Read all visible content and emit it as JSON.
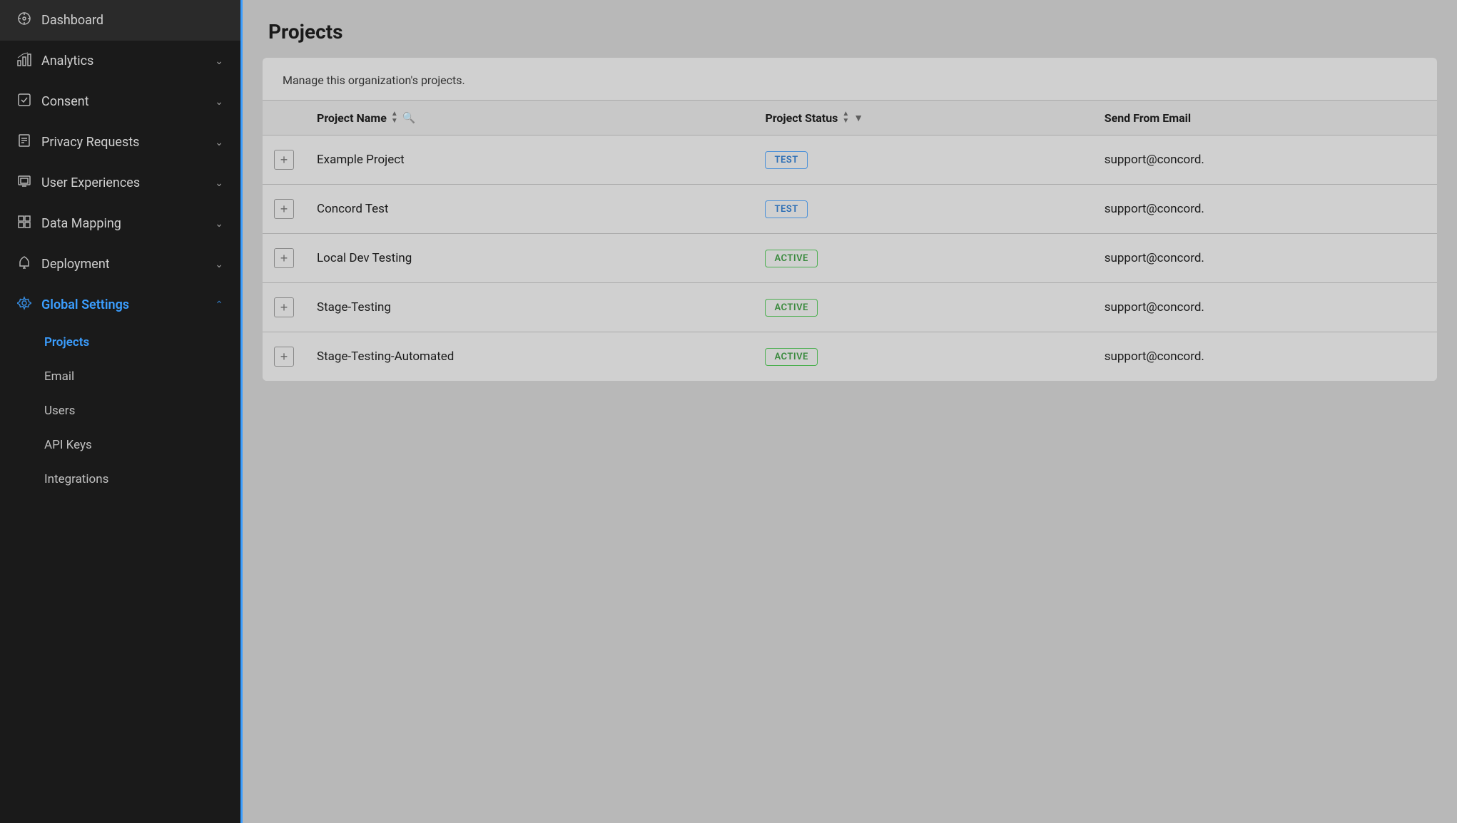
{
  "sidebar": {
    "items": [
      {
        "id": "dashboard",
        "label": "Dashboard",
        "icon": "⊙",
        "hasChevron": false,
        "active": false,
        "subItems": []
      },
      {
        "id": "analytics",
        "label": "Analytics",
        "icon": "📈",
        "hasChevron": true,
        "chevronDir": "down",
        "active": false,
        "subItems": []
      },
      {
        "id": "consent",
        "label": "Consent",
        "icon": "☑",
        "hasChevron": true,
        "chevronDir": "down",
        "active": false,
        "subItems": []
      },
      {
        "id": "privacy-requests",
        "label": "Privacy Requests",
        "icon": "🗂",
        "hasChevron": true,
        "chevronDir": "down",
        "active": false,
        "subItems": []
      },
      {
        "id": "user-experiences",
        "label": "User Experiences",
        "icon": "🖼",
        "hasChevron": true,
        "chevronDir": "down",
        "active": false,
        "subItems": []
      },
      {
        "id": "data-mapping",
        "label": "Data Mapping",
        "icon": "⊞",
        "hasChevron": true,
        "chevronDir": "down",
        "active": false,
        "subItems": []
      },
      {
        "id": "deployment",
        "label": "Deployment",
        "icon": "🔔",
        "hasChevron": true,
        "chevronDir": "down",
        "active": false,
        "subItems": []
      },
      {
        "id": "global-settings",
        "label": "Global Settings",
        "icon": "⚙",
        "hasChevron": true,
        "chevronDir": "up",
        "active": true,
        "subItems": [
          {
            "id": "projects",
            "label": "Projects",
            "active": true
          },
          {
            "id": "email",
            "label": "Email",
            "active": false
          },
          {
            "id": "users",
            "label": "Users",
            "active": false
          },
          {
            "id": "api-keys",
            "label": "API Keys",
            "active": false
          },
          {
            "id": "integrations",
            "label": "Integrations",
            "active": false
          }
        ]
      }
    ]
  },
  "main": {
    "title": "Projects",
    "description": "Manage this organization's projects.",
    "table": {
      "columns": [
        {
          "id": "expand",
          "label": "",
          "sortable": false,
          "searchable": false,
          "filterable": false
        },
        {
          "id": "project-name",
          "label": "Project Name",
          "sortable": true,
          "searchable": true,
          "filterable": false
        },
        {
          "id": "project-status",
          "label": "Project Status",
          "sortable": true,
          "searchable": false,
          "filterable": true
        },
        {
          "id": "send-from-email",
          "label": "Send From Email",
          "sortable": false,
          "searchable": false,
          "filterable": false
        }
      ],
      "rows": [
        {
          "id": 1,
          "projectName": "Example Project",
          "projectStatus": "TEST",
          "statusType": "test",
          "sendFromEmail": "support@concord."
        },
        {
          "id": 2,
          "projectName": "Concord Test",
          "projectStatus": "TEST",
          "statusType": "test",
          "sendFromEmail": "support@concord."
        },
        {
          "id": 3,
          "projectName": "Local Dev Testing",
          "projectStatus": "ACTIVE",
          "statusType": "active",
          "sendFromEmail": "support@concord."
        },
        {
          "id": 4,
          "projectName": "Stage-Testing",
          "projectStatus": "ACTIVE",
          "statusType": "active",
          "sendFromEmail": "support@concord."
        },
        {
          "id": 5,
          "projectName": "Stage-Testing-Automated",
          "projectStatus": "ACTIVE",
          "statusType": "active",
          "sendFromEmail": "support@concord."
        }
      ]
    }
  },
  "colors": {
    "sidebarBg": "#1a1a1a",
    "accent": "#3b9eff",
    "testBadgeBorder": "#4a90d9",
    "testBadgeText": "#2a6db5",
    "activeBadgeBorder": "#4caf50",
    "activeBadgeText": "#3a8a3e"
  }
}
